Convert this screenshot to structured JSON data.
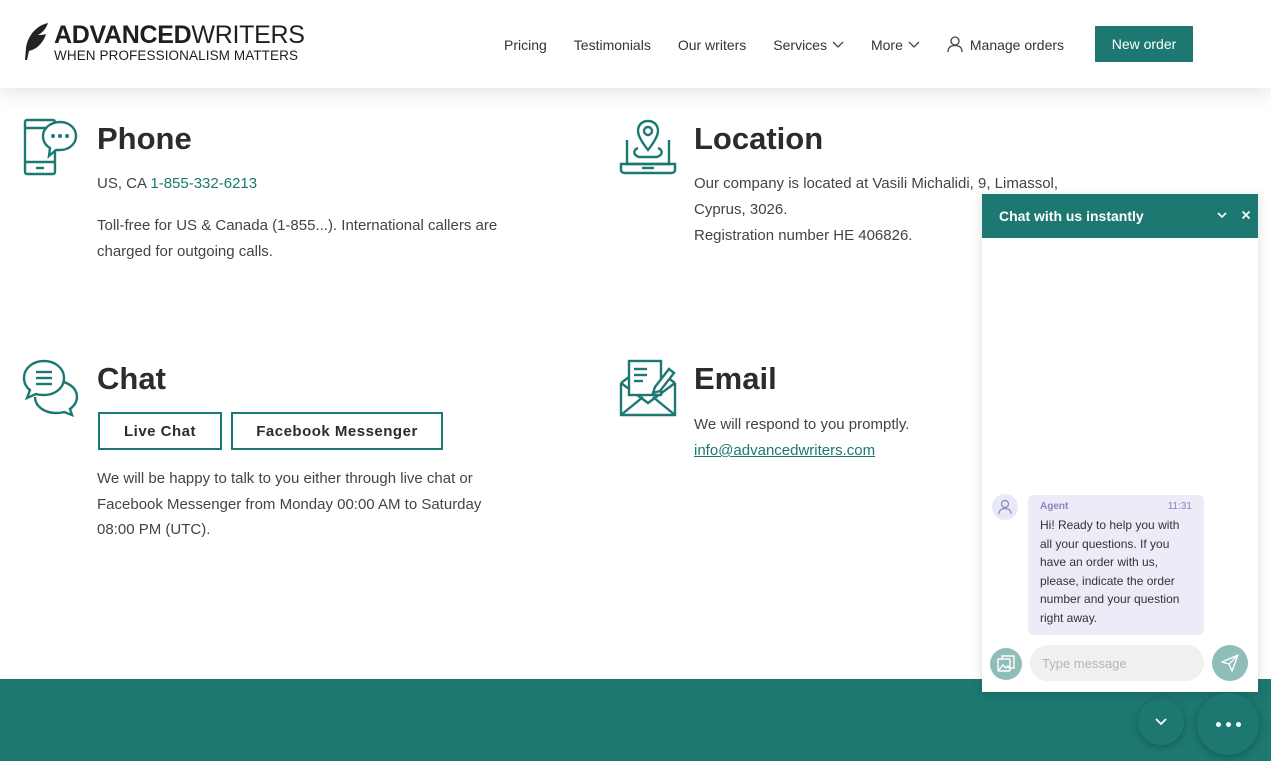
{
  "header": {
    "logo_bold": "ADVANCED",
    "logo_light": "WRITERS",
    "logo_tagline": "WHEN PROFESSIONALISM MATTERS",
    "nav": {
      "pricing": "Pricing",
      "testimonials": "Testimonials",
      "writers": "Our writers",
      "services": "Services",
      "more": "More",
      "manage": "Manage orders"
    },
    "new_order": "New order"
  },
  "phone": {
    "title": "Phone",
    "prefix": "US, CA ",
    "number": "1-855-332-6213",
    "desc_line1": "Toll-free for US & Canada (1-855...). International callers are",
    "desc_line2": "charged for outgoing calls."
  },
  "location": {
    "title": "Location",
    "line1": "Our company is located at Vasili Michalidi, 9, Limassol,",
    "line2": "Cyprus, 3026.",
    "line3": "Registration number HE 406826."
  },
  "chat_section": {
    "title": "Chat",
    "live_chat": "Live Chat",
    "messenger": "Facebook Messenger",
    "line1": "We will be happy to talk to you either through live chat or",
    "line2": "Facebook Messenger from Monday 00:00 AM to Saturday",
    "line3": "08:00 PM (UTC)."
  },
  "email": {
    "title": "Email",
    "desc": "We will respond to you promptly.",
    "address": "info@advancedwriters.com"
  },
  "widget": {
    "title": "Chat with us instantly",
    "agent": "Agent",
    "time": "11:31",
    "message": "Hi! Ready to help you with all your questions. If you have an order with us, please, indicate the order number and your question right away.",
    "placeholder": "Type message"
  },
  "colors": {
    "accent": "#1d7872",
    "muted_accent": "#8fbdb8",
    "bubble": "#ecebf7"
  }
}
